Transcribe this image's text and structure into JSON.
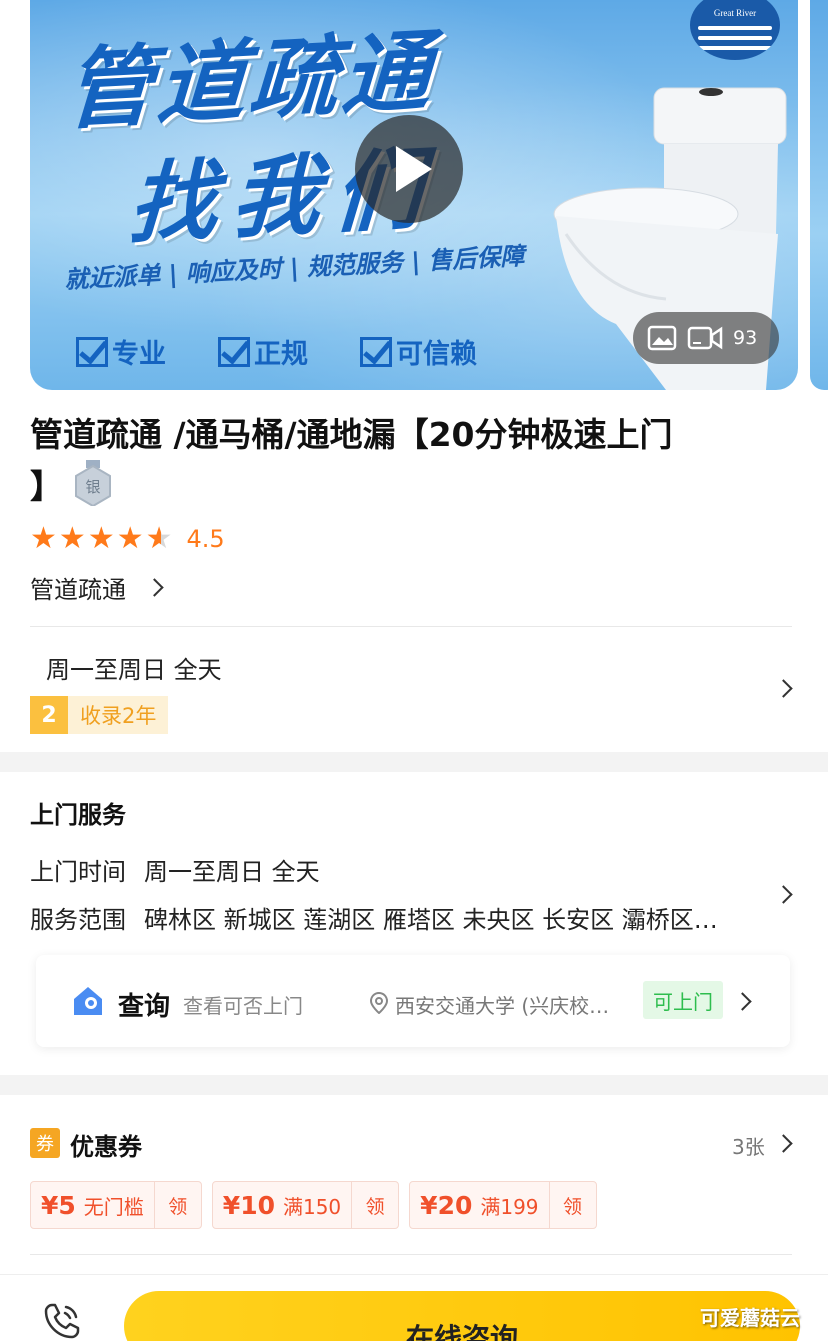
{
  "banner": {
    "headline_line1": "管道疏通",
    "headline_line2": "找我们",
    "slogan": "就近派单 | 响应及时 | 规范服务 | 售后保障",
    "badges": [
      "专业",
      "正规",
      "可信赖"
    ],
    "logo_text": "Great River",
    "media_count": "93"
  },
  "product": {
    "title": "管道疏通 /通马桶/通地漏【20分钟极速上门",
    "title_tail": "】",
    "level_badge": "银",
    "rating": 4.5,
    "rating_text": "4.5",
    "category": "管道疏通",
    "hours": "周一至周日 全天",
    "years_num": "2",
    "years_text": "收录2年"
  },
  "service": {
    "section_title": "上门服务",
    "time_label": "上门时间",
    "time_value": "周一至周日 全天",
    "range_label": "服务范围",
    "range_value": "碑林区 新城区 莲湖区 雁塔区 未央区 长安区 灞桥区…",
    "query": {
      "title": "查询",
      "subtitle": "查看可否上门",
      "location": "西安交通大学 (兴庆校…",
      "status": "可上门"
    }
  },
  "coupons": {
    "tag": "券",
    "title": "优惠券",
    "count": "3张",
    "items": [
      {
        "price": "¥5",
        "cond": "无门槛",
        "action": "领"
      },
      {
        "price": "¥10",
        "cond": "满150",
        "action": "领"
      },
      {
        "price": "¥20",
        "cond": "满199",
        "action": "领"
      }
    ]
  },
  "bottom": {
    "consult_label": "在线咨询"
  },
  "watermark": "可爱蘑菇云",
  "colors": {
    "accent_orange": "#ff7a1a",
    "brand_blue": "#1463c0",
    "status_green": "#2ebd4e",
    "cta_yellow": "#ffc300",
    "coupon_red": "#f0502b"
  }
}
